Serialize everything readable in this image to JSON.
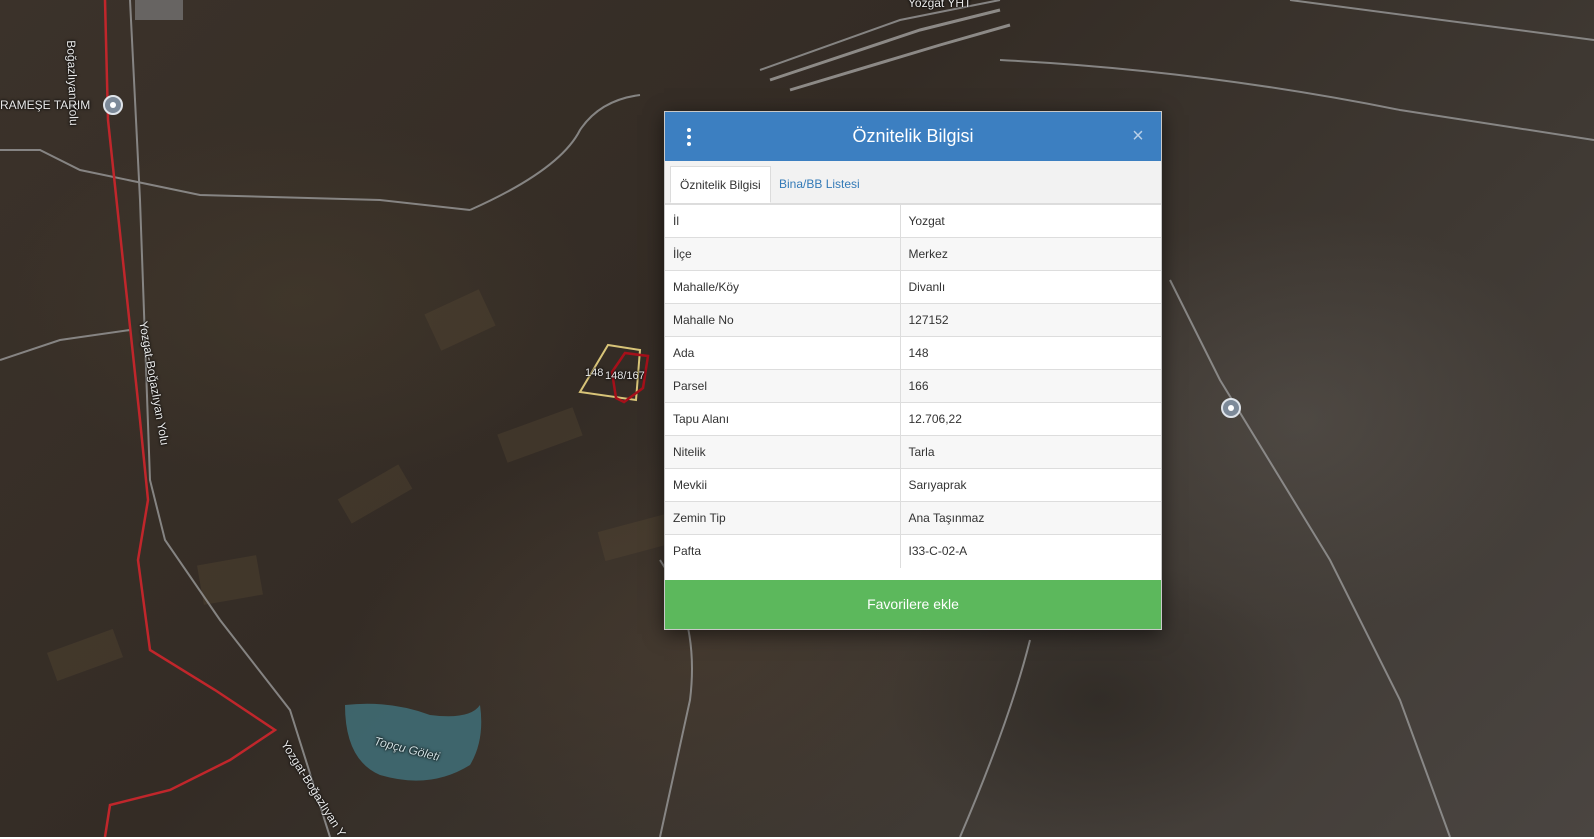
{
  "map": {
    "labels": {
      "road_top": "Boğazlıyan Yolu",
      "tarim": "RAMEŞE TARIM",
      "road_left": "Yozgat-Boğazlıyan Yolu",
      "road_bottom": "Yozgat-Boğazlıyan Y",
      "station": "Yozgat YHT",
      "lake": "Topçu Göleti",
      "parcel_a": "148",
      "parcel_b": "148/167"
    }
  },
  "dialog": {
    "title": "Öznitelik Bilgisi",
    "close_glyph": "×",
    "tabs": [
      {
        "label": "Öznitelik Bilgisi",
        "active": true
      },
      {
        "label": "Bina/BB Listesi",
        "active": false
      }
    ],
    "rows": [
      {
        "key": "İl",
        "value": "Yozgat"
      },
      {
        "key": "İlçe",
        "value": "Merkez"
      },
      {
        "key": "Mahalle/Köy",
        "value": "Divanlı"
      },
      {
        "key": "Mahalle No",
        "value": "127152"
      },
      {
        "key": "Ada",
        "value": "148"
      },
      {
        "key": "Parsel",
        "value": "166"
      },
      {
        "key": "Tapu Alanı",
        "value": "12.706,22"
      },
      {
        "key": "Nitelik",
        "value": "Tarla"
      },
      {
        "key": "Mevkii",
        "value": "Sarıyaprak"
      },
      {
        "key": "Zemin Tip",
        "value": "Ana Taşınmaz"
      },
      {
        "key": "Pafta",
        "value": "I33-C-02-A"
      }
    ],
    "favorite_button": "Favorilere ekle"
  },
  "colors": {
    "header": "#3c7fc1",
    "favorite": "#5cb85c",
    "road_highlight": "#c0262b"
  }
}
